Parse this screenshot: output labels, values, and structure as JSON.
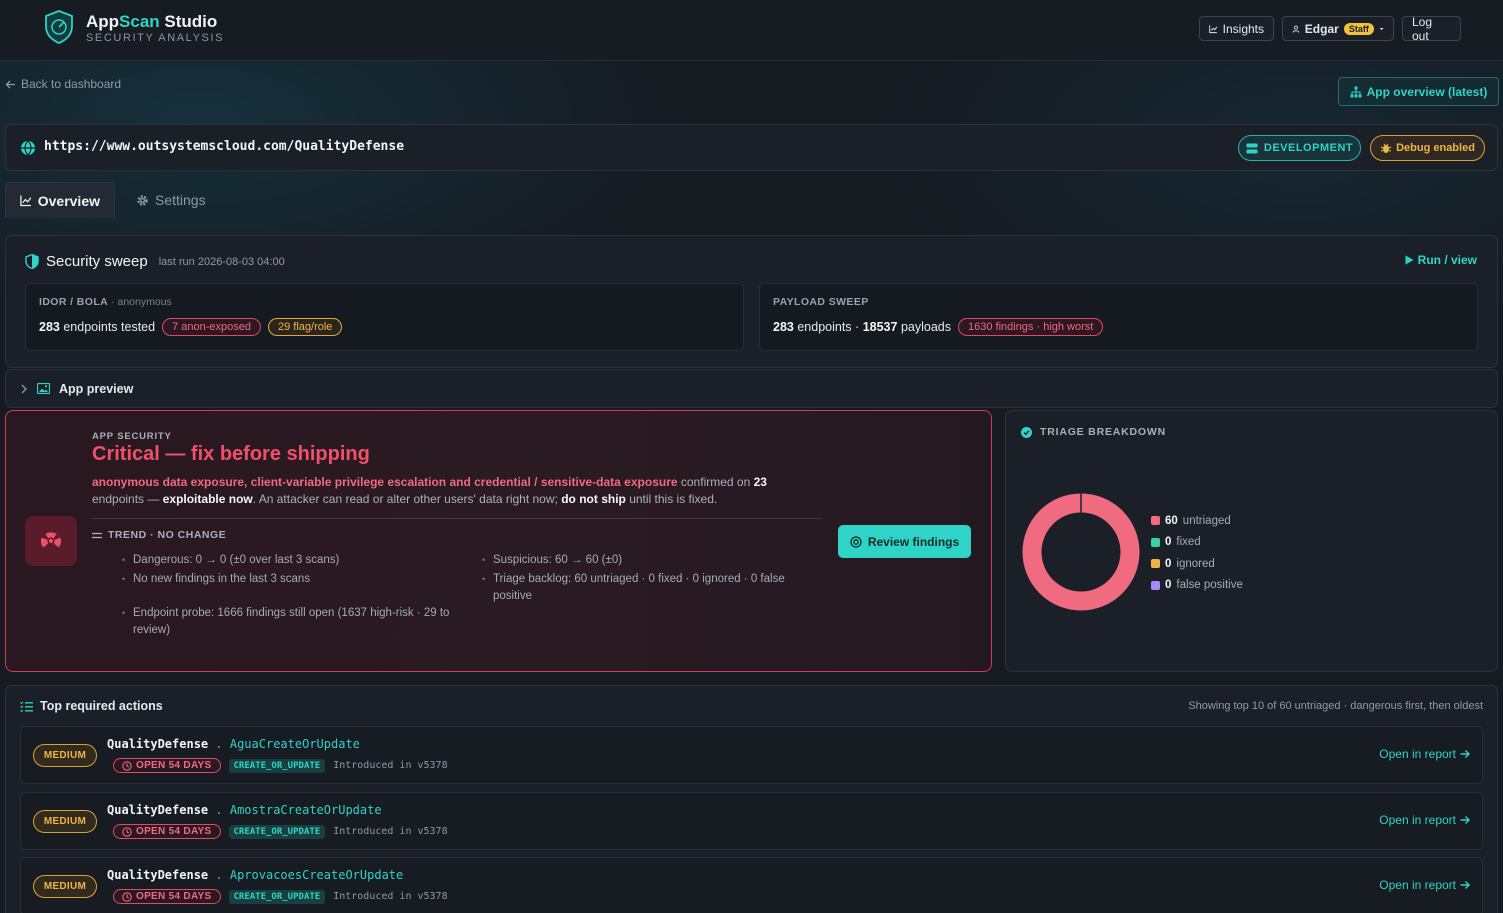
{
  "brand": {
    "name_a": "App",
    "name_b": "Scan",
    "name_c": " Studio",
    "subtitle": "SECURITY ANALYSIS"
  },
  "header": {
    "insights": "Insights",
    "user": "Edgar",
    "user_badge": "Staff",
    "logout": "Log out"
  },
  "nav": {
    "back": "Back to dashboard",
    "app_overview": "App overview (latest)"
  },
  "target": {
    "url": "https://www.outsystemscloud.com/QualityDefense",
    "env": "DEVELOPMENT",
    "debug": "Debug enabled"
  },
  "tabs": [
    {
      "label": "Overview",
      "active": true
    },
    {
      "label": "Settings",
      "active": false
    }
  ],
  "sweep": {
    "title": "Security sweep",
    "last_run": "last run 2026-08-03 04:00",
    "run_view": "Run / view",
    "idor": {
      "label": "IDOR / BOLA",
      "sub": "· anonymous",
      "endpoints_num": "283",
      "endpoints_text": "endpoints tested",
      "anon_exposed": "7 anon-exposed",
      "flag_role": "29 flag/role"
    },
    "payload": {
      "label": "PAYLOAD SWEEP",
      "endpoints_num": "283",
      "endpoints_text": "endpoints ·",
      "payloads_num": "18537",
      "payloads_text": "payloads",
      "findings": "1630 findings · high worst"
    }
  },
  "preview": {
    "label": "App preview"
  },
  "critical": {
    "eyebrow": "APP SECURITY",
    "title": "Critical — fix before shipping",
    "desc_red": "anonymous data exposure, client-variable privilege escalation and credential / sensitive-data exposure",
    "desc_1": " confirmed on ",
    "desc_count": "23",
    "desc_2": " endpoints — ",
    "desc_bold": "exploitable now",
    "desc_3": ". An attacker can read or alter other users' data right now; ",
    "desc_bold2": "do not ship",
    "desc_4": " until this is fixed.",
    "trend": "TREND · NO CHANGE",
    "bullets_left": [
      "Dangerous: 0 → 0 (±0 over last 3 scans)",
      "No new findings in the last 3 scans",
      "Endpoint probe: 1666 findings still open (1637 high-risk · 29 to review)"
    ],
    "bullets_right": [
      "Suspicious: 60 → 60 (±0)",
      "Triage backlog: 60 untriaged · 0 fixed · 0 ignored · 0 false positive"
    ],
    "review_button": "Review findings"
  },
  "triage": {
    "title": "TRIAGE BREAKDOWN",
    "items": [
      {
        "count": "60",
        "label": "untriaged",
        "color": "#f06a80",
        "value": 60
      },
      {
        "count": "0",
        "label": "fixed",
        "color": "#38d39f",
        "value": 0
      },
      {
        "count": "0",
        "label": "ignored",
        "color": "#f0b446",
        "value": 0
      },
      {
        "count": "0",
        "label": "false positive",
        "color": "#a78bfa",
        "value": 0
      }
    ]
  },
  "actions": {
    "title": "Top required actions",
    "note": "Showing top 10 of 60 untriaged · dangerous first, then oldest",
    "rows": [
      {
        "severity": "MEDIUM",
        "module": "QualityDefense",
        "sep": ".",
        "func": "AguaCreateOrUpdate",
        "open": "OPEN 54 DAYS",
        "op": "CREATE_OR_UPDATE",
        "introduced": "Introduced in v5378",
        "link": "Open in report"
      },
      {
        "severity": "MEDIUM",
        "module": "QualityDefense",
        "sep": ".",
        "func": "AmostraCreateOrUpdate",
        "open": "OPEN 54 DAYS",
        "op": "CREATE_OR_UPDATE",
        "introduced": "Introduced in v5378",
        "link": "Open in report"
      },
      {
        "severity": "MEDIUM",
        "module": "QualityDefense",
        "sep": ".",
        "func": "AprovacoesCreateOrUpdate",
        "open": "OPEN 54 DAYS",
        "op": "CREATE_OR_UPDATE",
        "introduced": "Introduced in v5378",
        "link": "Open in report"
      }
    ]
  },
  "colors": {
    "accent": "#2fd3c8",
    "danger": "#f0506a",
    "warning": "#f0b446"
  }
}
